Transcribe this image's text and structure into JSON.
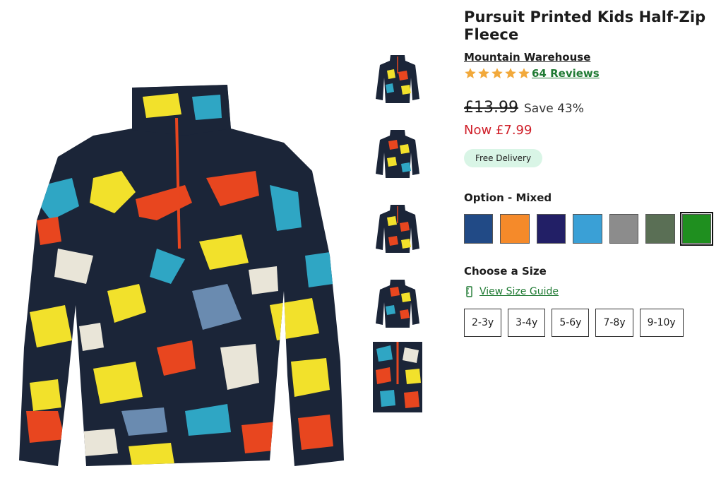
{
  "product": {
    "title": "Pursuit Printed Kids Half-Zip Fleece",
    "brand": "Mountain Warehouse",
    "rating": 5,
    "reviews_label": "64 Reviews",
    "was_price": "£13.99",
    "save_label": "Save 43%",
    "now_price": "Now £7.99",
    "delivery_badge": "Free Delivery"
  },
  "options": {
    "label": "Option - Mixed",
    "swatches": [
      "#214a86",
      "#f58a2a",
      "#221f66",
      "#3aa0d6",
      "#8c8c8c",
      "#5a6f55",
      "#1f8f1f"
    ],
    "selected_index": 6
  },
  "size": {
    "label": "Choose a Size",
    "guide_label": "View Size Guide",
    "options": [
      "2-3y",
      "3-4y",
      "5-6y",
      "7-8y",
      "9-10y"
    ]
  },
  "colors": {
    "accent_green": "#1f7a33",
    "sale_red": "#d0202a",
    "star": "#f2a93b",
    "badge_bg": "#d9f5e6"
  }
}
